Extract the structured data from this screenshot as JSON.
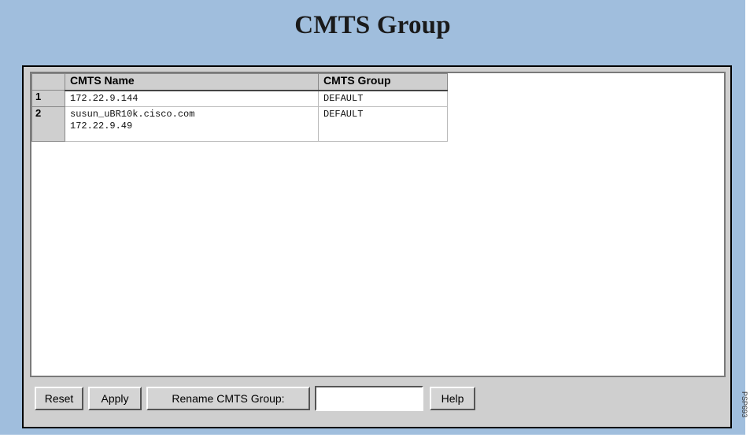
{
  "page": {
    "title": "CMTS Group"
  },
  "table": {
    "columns": [
      "CMTS Name",
      "CMTS Group"
    ],
    "rows": [
      {
        "num": "1",
        "name_lines": [
          "172.22.9.144"
        ],
        "group": "DEFAULT"
      },
      {
        "num": "2",
        "name_lines": [
          "susun_uBR10k.cisco.com",
          "172.22.9.49"
        ],
        "group": "DEFAULT"
      }
    ]
  },
  "buttons": {
    "reset": "Reset",
    "apply": "Apply",
    "rename": "Rename CMTS Group:",
    "help": "Help"
  },
  "rename_input": {
    "value": ""
  },
  "side_mark": "PSP693"
}
